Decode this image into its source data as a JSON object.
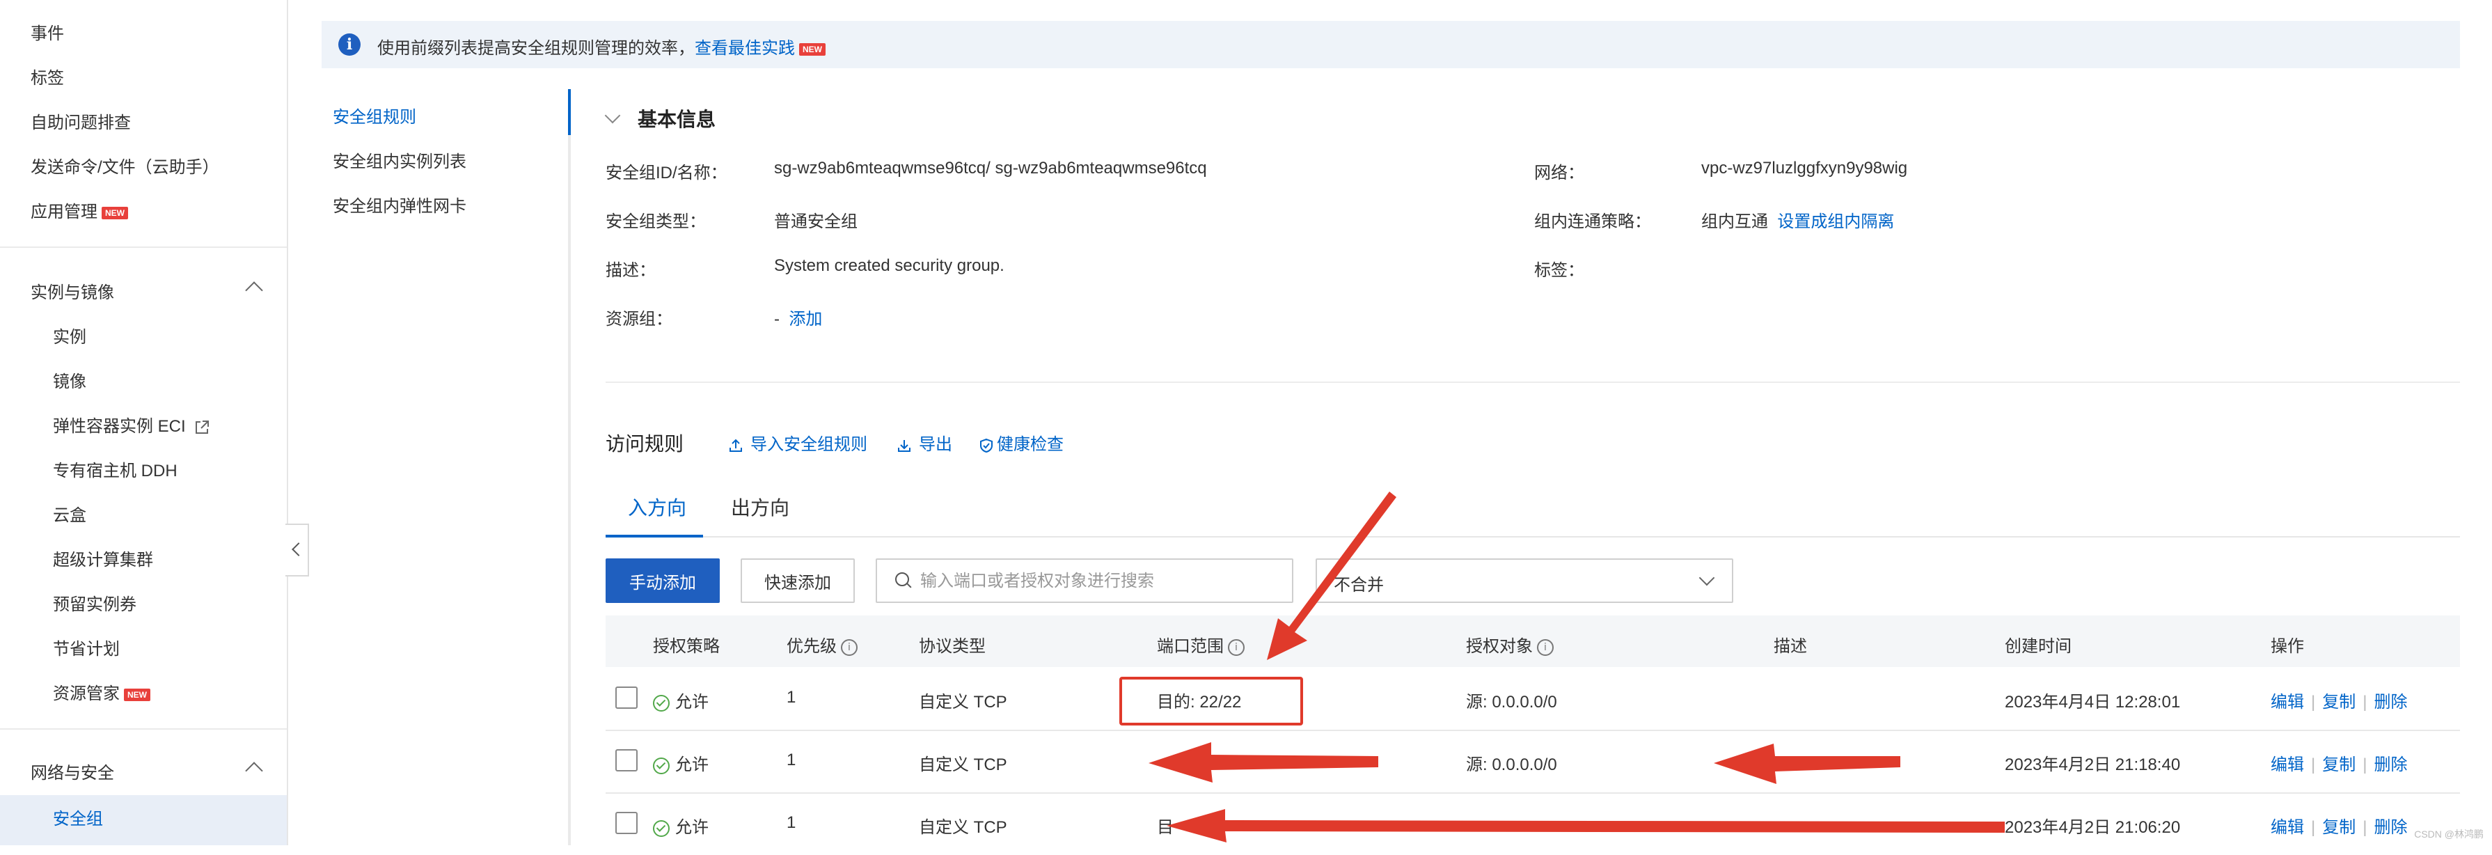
{
  "left_nav": {
    "top_items": [
      {
        "label": "事件"
      },
      {
        "label": "标签"
      },
      {
        "label": "自助问题排查"
      },
      {
        "label": "发送命令/文件（云助手）"
      },
      {
        "label": "应用管理",
        "badge": "NEW"
      }
    ],
    "group1": {
      "title": "实例与镜像",
      "items": [
        {
          "label": "实例"
        },
        {
          "label": "镜像"
        },
        {
          "label": "弹性容器实例 ECI"
        },
        {
          "label": "专有宿主机 DDH"
        },
        {
          "label": "云盒"
        },
        {
          "label": "超级计算集群"
        },
        {
          "label": "预留实例券"
        },
        {
          "label": "节省计划"
        },
        {
          "label": "资源管家",
          "badge": "NEW"
        }
      ]
    },
    "group2": {
      "title": "网络与安全",
      "items": [
        {
          "label": "安全组"
        }
      ]
    }
  },
  "banner": {
    "text": "使用前缀列表提高安全组规则管理的效率，",
    "link": "查看最佳实践",
    "badge": "NEW"
  },
  "subnav": {
    "items": [
      {
        "label": "安全组规则"
      },
      {
        "label": "安全组内实例列表"
      },
      {
        "label": "安全组内弹性网卡"
      }
    ]
  },
  "basic_info": {
    "title": "基本信息",
    "fields": {
      "id_label": "安全组ID/名称：",
      "id_value": "sg-wz9ab6mteaqwmse96tcq/ sg-wz9ab6mteaqwmse96tcq",
      "type_label": "安全组类型：",
      "type_value": "普通安全组",
      "desc_label": "描述：",
      "desc_value": "System created security group.",
      "rg_label": "资源组：",
      "rg_value": "-",
      "rg_link": "添加",
      "net_label": "网络：",
      "net_value": "vpc-wz97luzlggfxyn9y98wig",
      "policy_label": "组内连通策略：",
      "policy_value": "组内互通",
      "policy_link": "设置成组内隔离",
      "tag_label": "标签："
    }
  },
  "access_rules": {
    "title": "访问规则",
    "import_label": "导入安全组规则",
    "export_label": "导出",
    "health_label": "健康检查",
    "tabs": [
      {
        "label": "入方向"
      },
      {
        "label": "出方向"
      }
    ],
    "manual_add": "手动添加",
    "quick_add": "快速添加",
    "search_placeholder": "输入端口或者授权对象进行搜索",
    "merge_select": "不合并",
    "columns": {
      "policy": "授权策略",
      "priority": "优先级",
      "protocol": "协议类型",
      "port": "端口范围",
      "source": "授权对象",
      "desc": "描述",
      "created": "创建时间",
      "ops": "操作"
    },
    "rows": [
      {
        "policy": "允许",
        "priority": "1",
        "protocol": "自定义 TCP",
        "port": "目的: 22/22",
        "source": "源: 0.0.0.0/0",
        "created": "2023年4月4日 12:28:01"
      },
      {
        "policy": "允许",
        "priority": "1",
        "protocol": "自定义 TCP",
        "port": "",
        "source": "源: 0.0.0.0/0",
        "created": "2023年4月2日 21:18:40"
      },
      {
        "policy": "允许",
        "priority": "1",
        "protocol": "自定义 TCP",
        "port": "目",
        "source": "",
        "created": "2023年4月2日 21:06:20"
      }
    ],
    "ops": {
      "edit": "编辑",
      "copy": "复制",
      "delete": "删除"
    }
  },
  "watermark": "CSDN @林鸿鹏",
  "colors": {
    "accent": "#0064c8",
    "primary_button": "#1f5fbf",
    "annotation": "#e03a2b",
    "success": "#52a84a"
  }
}
